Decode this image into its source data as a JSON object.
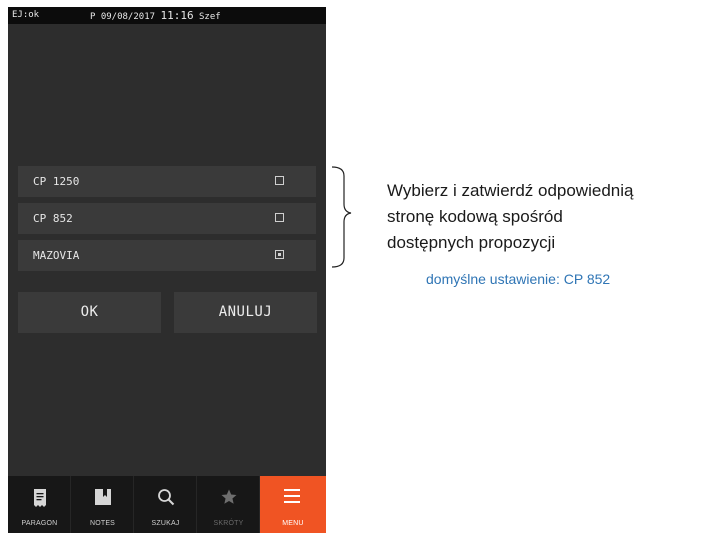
{
  "status_bar": {
    "left": "EJ:ok",
    "prefix": "P",
    "date": "09/08/2017",
    "time": "11:16",
    "user": "Szef"
  },
  "options": [
    {
      "label": "CP 1250",
      "checked": false
    },
    {
      "label": "CP 852",
      "checked": false
    },
    {
      "label": "MAZOVIA",
      "checked": true
    }
  ],
  "buttons": {
    "ok": "OK",
    "cancel": "ANULUJ"
  },
  "tabs": [
    {
      "label": "PARAGON",
      "icon": "receipt-icon",
      "active": false
    },
    {
      "label": "NOTES",
      "icon": "bookmark-icon",
      "active": false
    },
    {
      "label": "SZUKAJ",
      "icon": "search-icon",
      "active": false
    },
    {
      "label": "SKRÓTY",
      "icon": "star-icon",
      "active": false,
      "disabled": true
    },
    {
      "label": "MENU",
      "icon": "hamburger-icon",
      "active": true
    }
  ],
  "annotation": {
    "line1": "Wybierz i zatwierdź odpowiednią",
    "line2": "stronę kodową spośród",
    "line3": "dostępnych propozycji",
    "note": "domyślne ustawienie: CP 852"
  },
  "colors": {
    "accent": "#f05423",
    "note": "#2f75b5",
    "background": "#2d2d2d"
  }
}
